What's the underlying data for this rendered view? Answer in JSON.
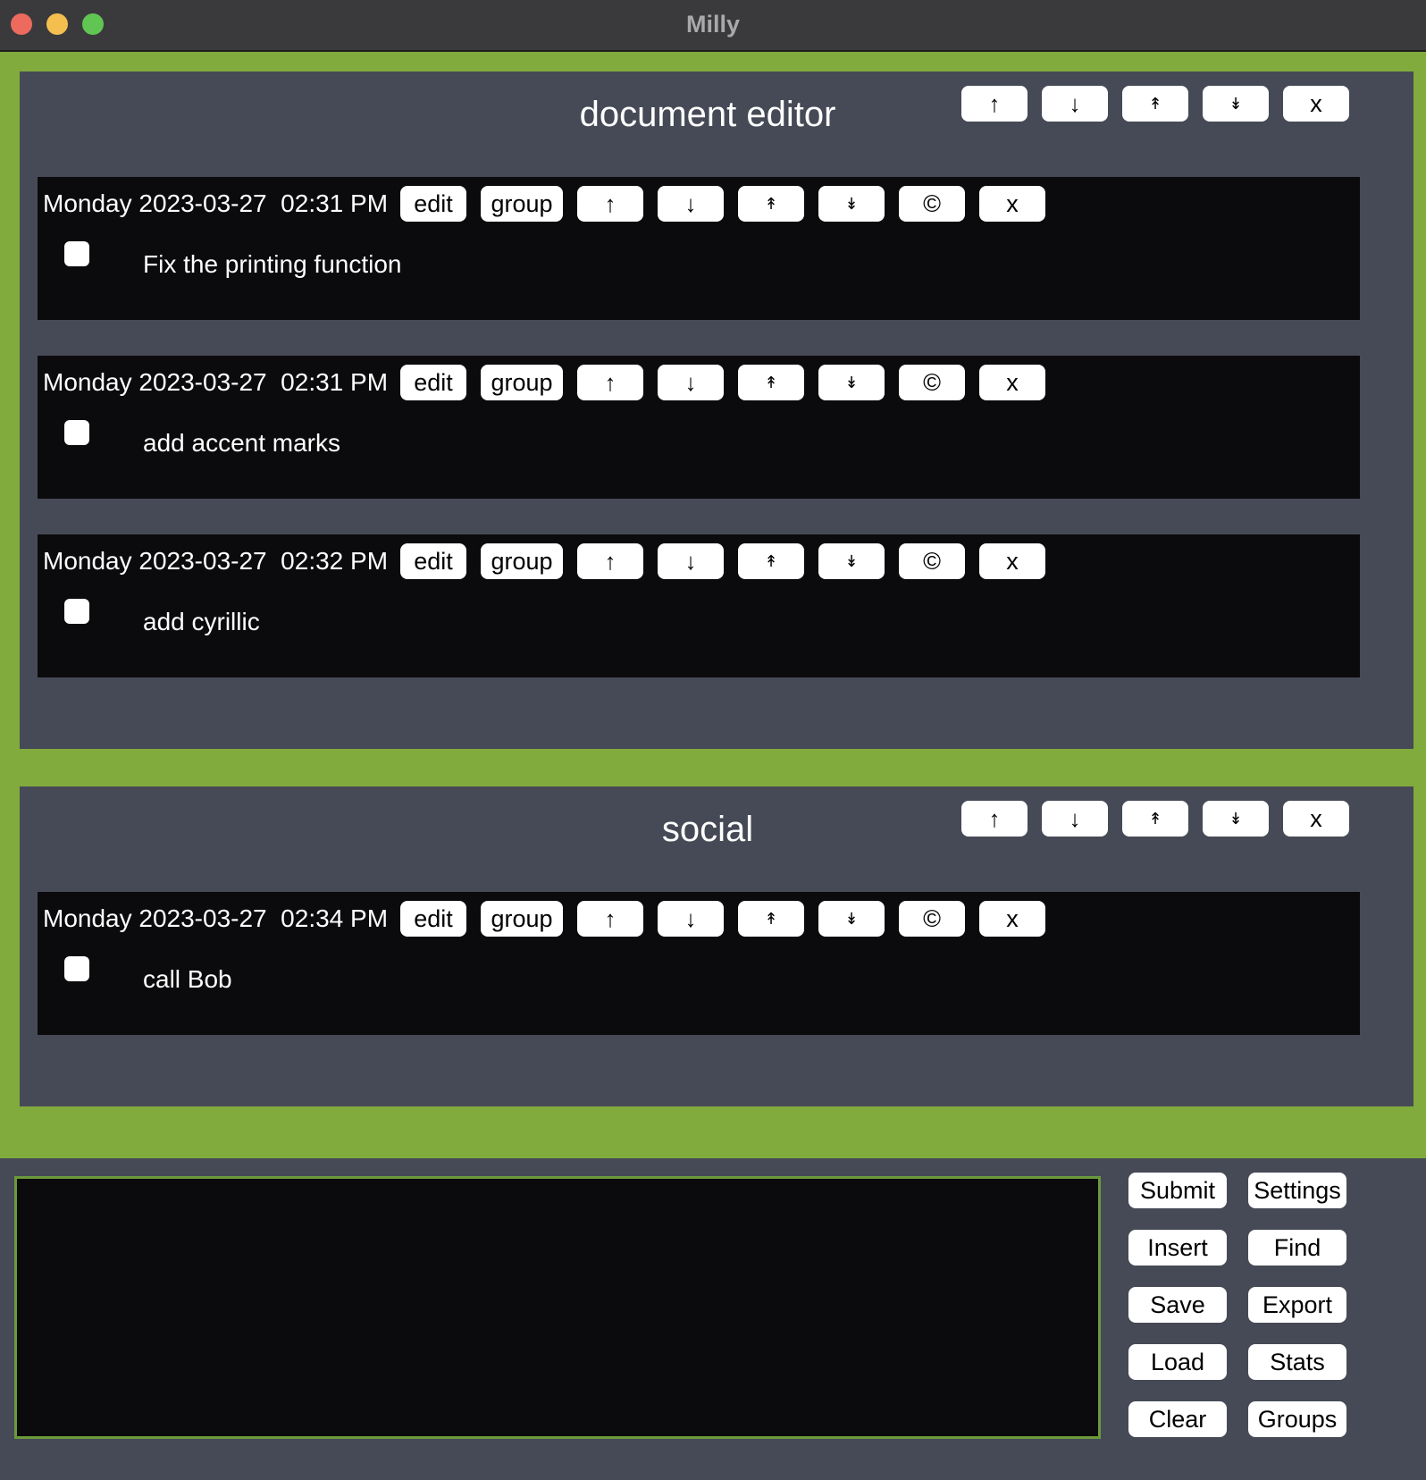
{
  "window": {
    "title": "Milly"
  },
  "groups": [
    {
      "title": "document editor",
      "controls": [
        "↑",
        "↓",
        "↟",
        "↡",
        "x"
      ],
      "tasks": [
        {
          "time": "Monday 2023-03-27  02:31 PM",
          "text": "Fix the printing function"
        },
        {
          "time": "Monday 2023-03-27  02:31 PM",
          "text": "add accent marks"
        },
        {
          "time": "Monday 2023-03-27  02:32 PM",
          "text": "add cyrillic"
        }
      ]
    },
    {
      "title": "social",
      "controls": [
        "↑",
        "↓",
        "↟",
        "↡",
        "x"
      ],
      "tasks": [
        {
          "time": "Monday 2023-03-27  02:34 PM",
          "text": "call Bob"
        }
      ]
    }
  ],
  "task_buttons": {
    "edit": "edit",
    "group": "group",
    "up": "↑",
    "down": "↓",
    "top": "↟",
    "bottom": "↡",
    "copy": "©",
    "delete": "x"
  },
  "input": {
    "value": ""
  },
  "side_buttons": {
    "submit": "Submit",
    "settings": "Settings",
    "insert": "Insert",
    "find": "Find",
    "save": "Save",
    "export": "Export",
    "load": "Load",
    "stats": "Stats",
    "clear": "Clear",
    "groups": "Groups"
  },
  "colors": {
    "accent_green": "#81ab3c",
    "panel": "#464a56",
    "task_bg": "#0b0a0c"
  }
}
